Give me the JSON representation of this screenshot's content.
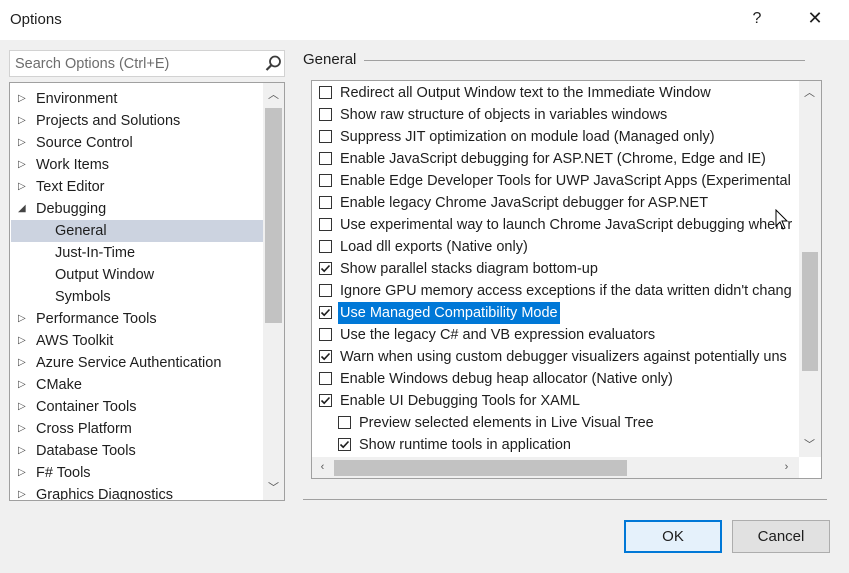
{
  "window": {
    "title": "Options",
    "help_label": "?",
    "close_label": "✕"
  },
  "search": {
    "placeholder": "Search Options (Ctrl+E)",
    "icon": "search-icon"
  },
  "tree": {
    "items": [
      {
        "label": "Environment",
        "level": 0,
        "expander": "collapsed"
      },
      {
        "label": "Projects and Solutions",
        "level": 0,
        "expander": "collapsed"
      },
      {
        "label": "Source Control",
        "level": 0,
        "expander": "collapsed"
      },
      {
        "label": "Work Items",
        "level": 0,
        "expander": "collapsed"
      },
      {
        "label": "Text Editor",
        "level": 0,
        "expander": "collapsed"
      },
      {
        "label": "Debugging",
        "level": 0,
        "expander": "expanded"
      },
      {
        "label": "General",
        "level": 1,
        "selected": true
      },
      {
        "label": "Just-In-Time",
        "level": 1
      },
      {
        "label": "Output Window",
        "level": 1
      },
      {
        "label": "Symbols",
        "level": 1
      },
      {
        "label": "Performance Tools",
        "level": 0,
        "expander": "collapsed"
      },
      {
        "label": "AWS Toolkit",
        "level": 0,
        "expander": "collapsed"
      },
      {
        "label": "Azure Service Authentication",
        "level": 0,
        "expander": "collapsed"
      },
      {
        "label": "CMake",
        "level": 0,
        "expander": "collapsed"
      },
      {
        "label": "Container Tools",
        "level": 0,
        "expander": "collapsed"
      },
      {
        "label": "Cross Platform",
        "level": 0,
        "expander": "collapsed"
      },
      {
        "label": "Database Tools",
        "level": 0,
        "expander": "collapsed"
      },
      {
        "label": "F# Tools",
        "level": 0,
        "expander": "collapsed"
      },
      {
        "label": "Graphics Diagnostics",
        "level": 0,
        "expander": "collapsed"
      }
    ]
  },
  "general": {
    "title": "General",
    "options": [
      {
        "label": "Redirect all Output Window text to the Immediate Window",
        "checked": false,
        "indent": 0
      },
      {
        "label": "Show raw structure of objects in variables windows",
        "checked": false,
        "indent": 0
      },
      {
        "label": "Suppress JIT optimization on module load (Managed only)",
        "checked": false,
        "indent": 0
      },
      {
        "label": "Enable JavaScript debugging for ASP.NET (Chrome, Edge and IE)",
        "checked": false,
        "indent": 0
      },
      {
        "label": "Enable Edge Developer Tools for UWP JavaScript Apps (Experimental",
        "checked": false,
        "indent": 0
      },
      {
        "label": "Enable legacy Chrome JavaScript debugger for ASP.NET",
        "checked": false,
        "indent": 0
      },
      {
        "label": "Use experimental way to launch Chrome JavaScript debugging when r",
        "checked": false,
        "indent": 0
      },
      {
        "label": "Load dll exports (Native only)",
        "checked": false,
        "indent": 0
      },
      {
        "label": "Show parallel stacks diagram bottom-up",
        "checked": true,
        "indent": 0
      },
      {
        "label": "Ignore GPU memory access exceptions if the data written didn't chang",
        "checked": false,
        "indent": 0
      },
      {
        "label": "Use Managed Compatibility Mode",
        "checked": true,
        "indent": 0,
        "highlighted": true
      },
      {
        "label": "Use the legacy C# and VB expression evaluators",
        "checked": false,
        "indent": 0
      },
      {
        "label": "Warn when using custom debugger visualizers against potentially uns",
        "checked": true,
        "indent": 0
      },
      {
        "label": "Enable Windows debug heap allocator (Native only)",
        "checked": false,
        "indent": 0
      },
      {
        "label": "Enable UI Debugging Tools for XAML",
        "checked": true,
        "indent": 0
      },
      {
        "label": "Preview selected elements in Live Visual Tree",
        "checked": false,
        "indent": 1
      },
      {
        "label": "Show runtime tools in application",
        "checked": true,
        "indent": 1
      }
    ]
  },
  "buttons": {
    "ok": "OK",
    "cancel": "Cancel"
  },
  "colors": {
    "accent": "#0078d7",
    "tree_selected": "#ccd3e0",
    "scroll_thumb": "#c2c2c2"
  }
}
